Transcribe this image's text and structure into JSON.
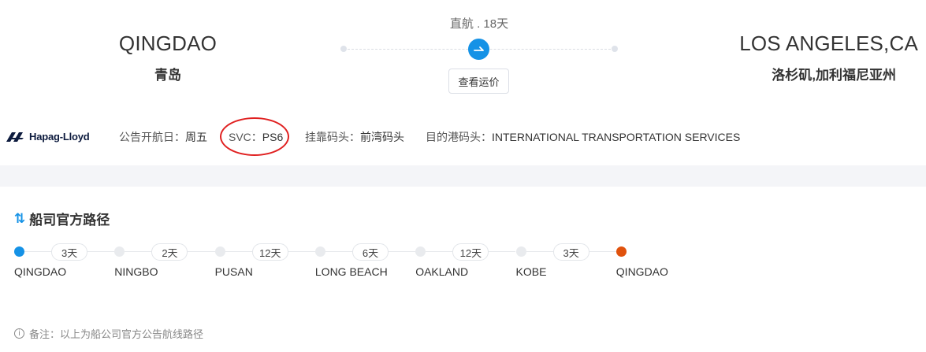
{
  "origin": {
    "name_en": "QINGDAO",
    "name_cn": "青岛"
  },
  "destination": {
    "name_en": "LOS ANGELES,CA",
    "name_cn": "洛杉矶,加利福尼亚州"
  },
  "route": {
    "label": "直航 . 18天",
    "rate_button": "查看运价",
    "accent": "#1592e6"
  },
  "carrier": {
    "logo_text": "Hapag-Lloyd",
    "sailing_day_label": "公告开航日：",
    "sailing_day_value": "周五",
    "svc_label": "SVC：",
    "svc_value": "PS6",
    "berth_label": "挂靠码头：",
    "berth_value": "前湾码头",
    "dest_terminal_label": "目的港码头：",
    "dest_terminal_value": "INTERNATIONAL TRANSPORTATION SERVICES"
  },
  "official_route": {
    "title": "船司官方路径",
    "stops": [
      "QINGDAO",
      "NINGBO",
      "PUSAN",
      "LONG BEACH",
      "OAKLAND",
      "KOBE",
      "QINGDAO"
    ],
    "legs": [
      "3天",
      "2天",
      "12天",
      "6天",
      "12天",
      "3天"
    ],
    "colors": {
      "start": "#1592e6",
      "end": "#e0520d",
      "middle": "#e9ebee"
    }
  },
  "note": "备注：以上为船公司官方公告航线路径"
}
